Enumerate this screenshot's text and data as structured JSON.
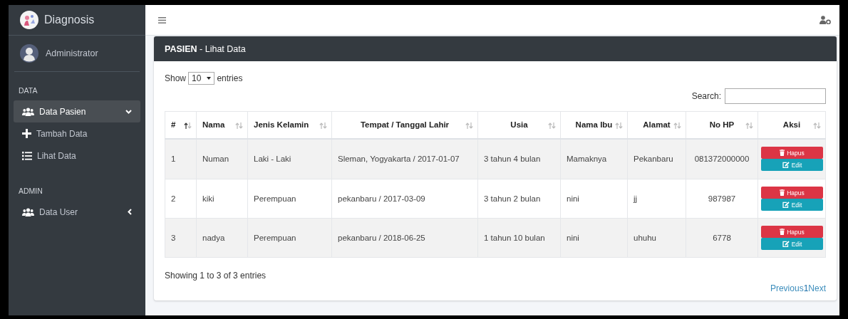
{
  "brand": {
    "title": "Diagnosis"
  },
  "user": {
    "name": "Administrator"
  },
  "sidebar": {
    "sections": [
      {
        "header": "DATA",
        "items": [
          {
            "label": "Data Pasien",
            "kind": "users",
            "selected": true,
            "expanded": true,
            "children": [
              {
                "label": "Tambah Data",
                "kind": "plus",
                "selected": false
              },
              {
                "label": "Lihat Data",
                "kind": "list",
                "selected": false
              }
            ]
          }
        ]
      },
      {
        "header": "ADMIN",
        "items": [
          {
            "label": "Data User",
            "kind": "users",
            "selected": false,
            "expanded": false
          }
        ]
      }
    ]
  },
  "card": {
    "title_bold": "PASIEN",
    "title_rest": " - Lihat Data"
  },
  "length_menu": {
    "before": "Show",
    "value": "10",
    "after": "entries"
  },
  "search": {
    "label": "Search:"
  },
  "table": {
    "columns": [
      {
        "label": "#",
        "sorted": true
      },
      {
        "label": "Nama",
        "sorted": false
      },
      {
        "label": "Jenis Kelamin",
        "sorted": false
      },
      {
        "label": "Tempat / Tanggal Lahir",
        "sorted": false
      },
      {
        "label": "Usia",
        "sorted": false
      },
      {
        "label": "Nama Ibu",
        "sorted": false
      },
      {
        "label": "Alamat",
        "sorted": false
      },
      {
        "label": "No HP",
        "sorted": false
      },
      {
        "label": "Aksi",
        "sorted": false
      }
    ],
    "rows": [
      {
        "cells": [
          "1",
          "Numan",
          "Laki - Laki",
          "Sleman, Yogyakarta / 2017-01-07",
          "3 tahun 4 bulan",
          "Mamaknya",
          "Pekanbaru",
          "081372000000"
        ],
        "actions": [
          {
            "label": "Hapus",
            "kind": "delete"
          },
          {
            "label": "Edit",
            "kind": "edit"
          }
        ]
      },
      {
        "cells": [
          "2",
          "kiki",
          "Perempuan",
          "pekanbaru / 2017-03-09",
          "3 tahun 2 bulan",
          "nini",
          "jj",
          "987987"
        ],
        "actions": [
          {
            "label": "Hapus",
            "kind": "delete"
          },
          {
            "label": "Edit",
            "kind": "edit"
          }
        ]
      },
      {
        "cells": [
          "3",
          "nadya",
          "Perempuan",
          "pekanbaru / 2018-06-25",
          "1 tahun 10 bulan",
          "nini",
          "uhuhu",
          "6778"
        ],
        "actions": [
          {
            "label": "Hapus",
            "kind": "delete"
          },
          {
            "label": "Edit",
            "kind": "edit"
          }
        ]
      }
    ]
  },
  "info": "Showing 1 to 3 of 3 entries",
  "pagination": [
    {
      "label": "Previous",
      "selected": false
    },
    {
      "label": "1",
      "selected": true
    },
    {
      "label": "Next",
      "selected": false
    }
  ]
}
